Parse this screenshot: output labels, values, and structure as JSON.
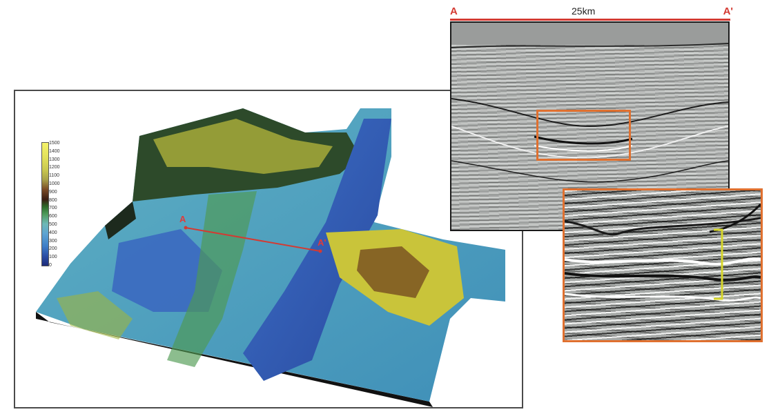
{
  "map": {
    "color_scale_labels": [
      "1500",
      "1400",
      "1300",
      "1200",
      "1100",
      "1000",
      "900",
      "800",
      "700",
      "600",
      "500",
      "400",
      "300",
      "200",
      "100",
      "0"
    ],
    "point_a": "A",
    "point_a_prime": "A'"
  },
  "section": {
    "label_start": "A",
    "label_end": "A'",
    "distance": "25km"
  },
  "colors": {
    "profile_line": "#d43a32",
    "highlight_box": "#e0702f",
    "marker_bracket": "#d6d62a"
  }
}
